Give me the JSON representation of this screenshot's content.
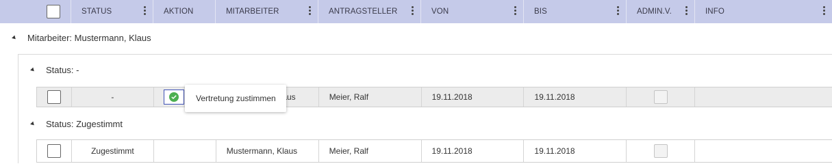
{
  "header": {
    "columns": [
      {
        "label": ""
      },
      {
        "label": "STATUS"
      },
      {
        "label": "AKTION"
      },
      {
        "label": "MITARBEITER"
      },
      {
        "label": "ANTRAGSTELLER"
      },
      {
        "label": "VON"
      },
      {
        "label": "BIS"
      },
      {
        "label": "ADMIN.V."
      },
      {
        "label": "INFO"
      }
    ]
  },
  "groups": {
    "employee": "Mitarbeiter: Mustermann, Klaus",
    "status_none": "Status: -",
    "status_approved": "Status: Zugestimmt"
  },
  "rows": [
    {
      "status": "-",
      "mitarbeiter": "aus",
      "antragsteller": "Meier, Ralf",
      "von": "19.11.2018",
      "bis": "19.11.2018"
    },
    {
      "status": "Zugestimmt",
      "mitarbeiter": "Mustermann, Klaus",
      "antragsteller": "Meier, Ralf",
      "von": "19.11.2018",
      "bis": "19.11.2018"
    }
  ],
  "tooltip": {
    "text": "Vertretung zustimmen"
  },
  "colors": {
    "header_bg": "#c5cae9",
    "approve_icon": "#4caf50",
    "action_border": "#3f51b5"
  }
}
